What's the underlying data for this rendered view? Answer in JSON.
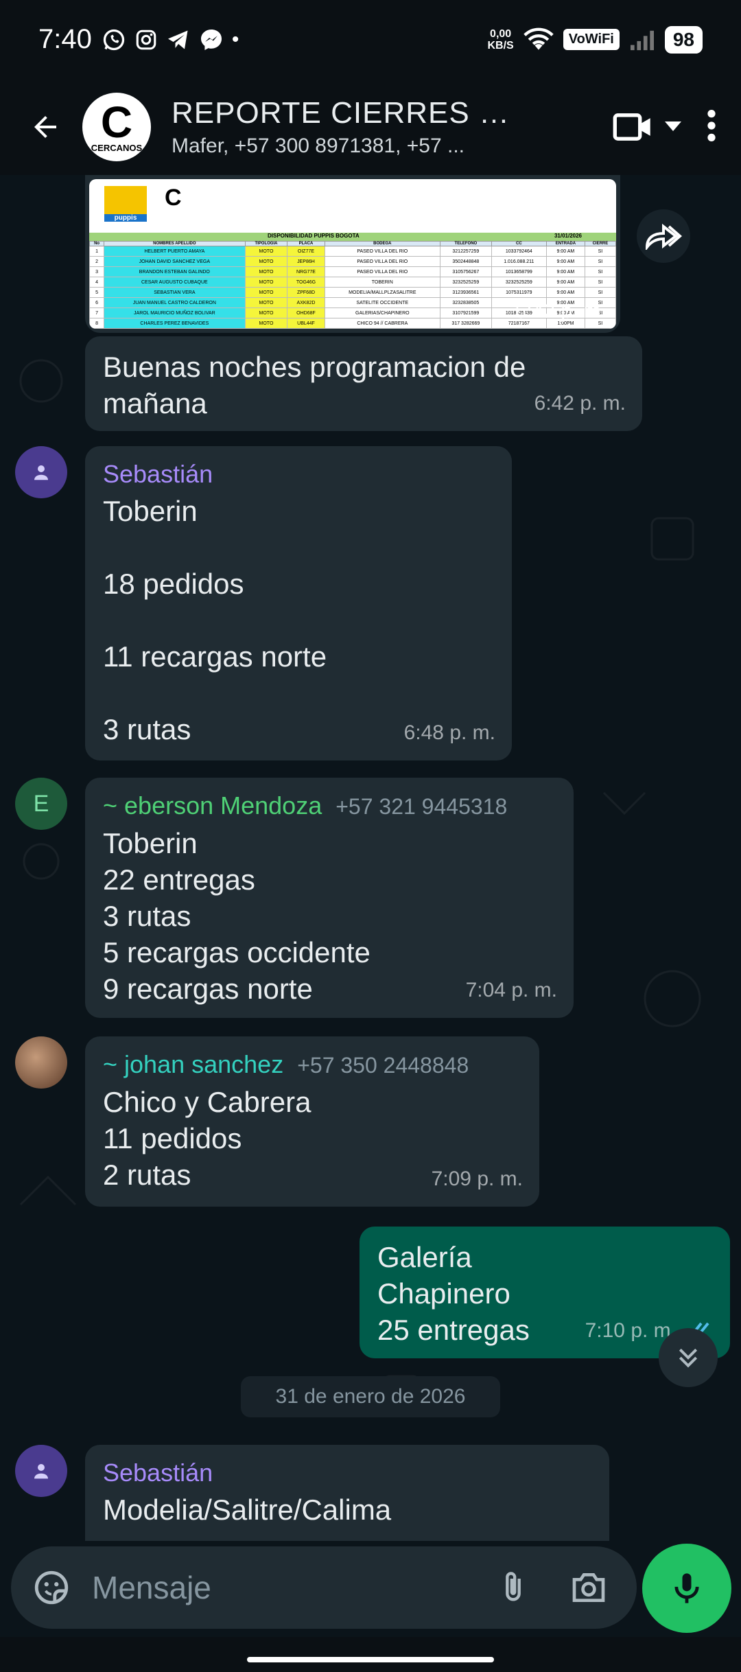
{
  "status_bar": {
    "time": "7:40",
    "net_speed_value": "0,00",
    "net_speed_unit": "KB/S",
    "vowifi": "VoWiFi",
    "battery": "98"
  },
  "header": {
    "title": "REPORTE CIERRES P...",
    "subtitle": "Mafer, +57 300 8971381, +57 ...",
    "avatar_letter": "C",
    "avatar_text": "CERCANOS"
  },
  "image_message": {
    "time": "6:42 p. m.",
    "sheet_title": "DISPONIBILIDAD PUPPIS BOGOTA",
    "sheet_date": "31/01/2026",
    "brand": "puppis",
    "headers": [
      "No",
      "NOMBRES APELLIDO",
      "TIPOLOGIA",
      "PLACA",
      "BODEGA",
      "TELEFONO",
      "CC",
      "ENTRADA",
      "CIERRE"
    ],
    "rows": [
      [
        "1",
        "HELBERT PUERTO AMAYA",
        "MOTO",
        "OIZ77E",
        "PASEO VILLA DEL RIO",
        "3212257259",
        "1033792464",
        "9:00 AM",
        "SI"
      ],
      [
        "2",
        "JOHAN DAVID SANCHEZ VEGA",
        "MOTO",
        "JEP86H",
        "PASEO VILLA DEL RIO",
        "3502448848",
        "1.016.088.211",
        "9:00 AM",
        "SI"
      ],
      [
        "3",
        "BRANDON ESTEBAN GALINDO",
        "MOTO",
        "NRG77E",
        "PASEO VILLA DEL RIO",
        "3105756267",
        "1013658799",
        "9:00 AM",
        "SI"
      ],
      [
        "4",
        "CESAR AUGUSTO CUBAQUE",
        "MOTO",
        "TOG46G",
        "TOBERIN",
        "3232525259",
        "3232525259",
        "9:00 AM",
        "SI"
      ],
      [
        "5",
        "SEBASTIAN VERA",
        "MOTO",
        "ZPF68D",
        "MODELIA/MALLPLZASALITRE",
        "3123936561",
        "1075311979",
        "9:00 AM",
        "SI"
      ],
      [
        "6",
        "JUAN MANUEL CASTRO CALDERON",
        "MOTO",
        "AXK82D",
        "SATELITE OCCIDENTE",
        "3232838505",
        "",
        "9:00 AM",
        "SI"
      ],
      [
        "7",
        "JAROL MAURICIO MUÑOZ BOLIVAR",
        "MOTO",
        "OHD68F",
        "GALERIAS/CHAPINERO",
        "3107921599",
        "1018425439",
        "9:00 AM",
        "SI"
      ],
      [
        "8",
        "CHARLES PEREZ BENAVIDES",
        "MOTO",
        "UBL44F",
        "CHICO 94 // CABRERA",
        "317 3282669",
        "72187167",
        "1:00PM",
        "SI"
      ]
    ]
  },
  "messages": [
    {
      "text": "Buenas noches programacion de\nmañana",
      "time": "6:42 p. m."
    },
    {
      "sender": "Sebastián",
      "text": "Toberin\n\n18 pedidos\n\n11 recargas norte\n\n3 rutas",
      "time": "6:48 p. m."
    },
    {
      "sender": "~ eberson Mendoza",
      "phone": "+57 321 9445318",
      "avatar_letter": "E",
      "text": "Toberin\n22 entregas\n3 rutas\n5 recargas occidente\n9 recargas norte",
      "time": "7:04 p. m."
    },
    {
      "sender": "~ johan sanchez",
      "phone": "+57 350 2448848",
      "text": "Chico y Cabrera\n11 pedidos\n2 rutas",
      "time": "7:09 p. m."
    },
    {
      "text": "Galería\nChapinero\n25 entregas",
      "time": "7:10 p. m."
    },
    {
      "sender": "Sebastián",
      "text": "Modelia/Salitre/Calima"
    }
  ],
  "date_chip": "31 de enero de 2026",
  "composer": {
    "placeholder": "Mensaje"
  },
  "colors": {
    "accent_green": "#21c063",
    "sender_purple": "#a78bfa",
    "sender_green": "#4fd176",
    "sender_teal": "#34d1bf",
    "outgoing_bubble": "#005c4b",
    "incoming_bubble": "#202c33",
    "read_ticks": "#53bdeb"
  },
  "icons": [
    "whatsapp-icon",
    "instagram-icon",
    "telegram-icon",
    "messenger-icon",
    "wifi-icon",
    "signal-icon",
    "back-arrow-icon",
    "video-call-icon",
    "dropdown-icon",
    "more-icon",
    "forward-icon",
    "emoji-sticker-icon",
    "attach-icon",
    "camera-icon",
    "mic-icon",
    "double-chevron-down-icon",
    "read-ticks-icon"
  ]
}
